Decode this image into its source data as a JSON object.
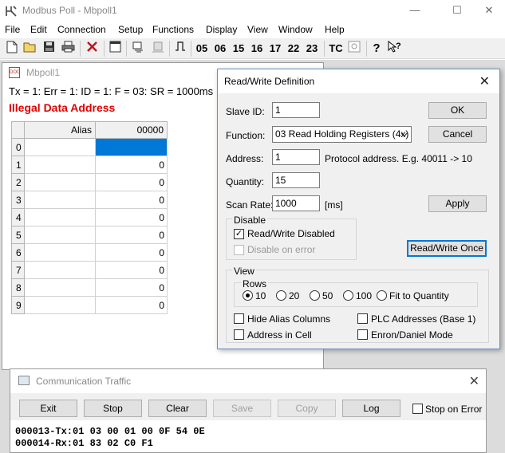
{
  "app": {
    "title": "Modbus Poll - Mbpoll1",
    "minimize": "—",
    "maximize": "☐",
    "close": "✕"
  },
  "menu": [
    "File",
    "Edit",
    "Connection",
    "Setup",
    "Functions",
    "Display",
    "View",
    "Window",
    "Help"
  ],
  "toolbar": {
    "function_codes": [
      "05",
      "06",
      "15",
      "16",
      "17",
      "22",
      "23"
    ],
    "tc": "TC"
  },
  "child": {
    "title": "Mbpoll1",
    "status": "Tx = 1: Err = 1: ID = 1: F = 03: SR = 1000ms",
    "error": "Illegal Data Address",
    "columns": [
      "Alias",
      "00000"
    ],
    "rows": [
      {
        "index": "0",
        "alias": "",
        "value": ""
      },
      {
        "index": "1",
        "alias": "",
        "value": "0"
      },
      {
        "index": "2",
        "alias": "",
        "value": "0"
      },
      {
        "index": "3",
        "alias": "",
        "value": "0"
      },
      {
        "index": "4",
        "alias": "",
        "value": "0"
      },
      {
        "index": "5",
        "alias": "",
        "value": "0"
      },
      {
        "index": "6",
        "alias": "",
        "value": "0"
      },
      {
        "index": "7",
        "alias": "",
        "value": "0"
      },
      {
        "index": "8",
        "alias": "",
        "value": "0"
      },
      {
        "index": "9",
        "alias": "",
        "value": "0"
      }
    ]
  },
  "dialog": {
    "title": "Read/Write Definition",
    "slave_id_label": "Slave ID:",
    "slave_id": "1",
    "function_label": "Function:",
    "function": "03 Read Holding Registers (4x)",
    "address_label": "Address:",
    "address": "1",
    "address_hint": "Protocol address. E.g. 40011 -> 10",
    "quantity_label": "Quantity:",
    "quantity": "15",
    "scan_rate_label": "Scan Rate:",
    "scan_rate": "1000",
    "scan_rate_unit": "[ms]",
    "ok": "OK",
    "cancel": "Cancel",
    "apply": "Apply",
    "read_write_once": "Read/Write Once",
    "disable_group": "Disable",
    "rw_disabled": "Read/Write Disabled",
    "disable_on_error": "Disable on error",
    "view_group": "View",
    "rows_group": "Rows",
    "rows_options": [
      "10",
      "20",
      "50",
      "100",
      "Fit to Quantity"
    ],
    "hide_alias": "Hide Alias Columns",
    "address_in_cell": "Address in Cell",
    "plc_addresses": "PLC Addresses (Base 1)",
    "enron_mode": "Enron/Daniel Mode",
    "checkmark": "✓"
  },
  "comm": {
    "title": "Communication Traffic",
    "buttons": [
      "Exit",
      "Stop",
      "Clear",
      "Save",
      "Copy",
      "Log"
    ],
    "stop_on_error": "Stop on Error",
    "lines": [
      "000013-Tx:01 03 00 01 00 0F 54 0E",
      "000014-Rx:01 83 02 C0 F1"
    ]
  }
}
